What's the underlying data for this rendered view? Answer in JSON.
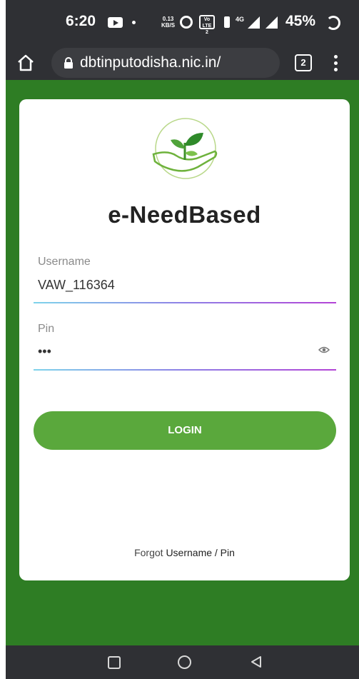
{
  "status_bar": {
    "time": "6:20",
    "net_speed_value": "0.13",
    "net_speed_unit": "KB/S",
    "volte_label": "Vo LTE 2",
    "network_type": "4G",
    "battery": "45%"
  },
  "browser": {
    "url": "dbtinputodisha.nic.in/",
    "tab_count": "2"
  },
  "login": {
    "app_title": "e-NeedBased",
    "username_label": "Username",
    "username_value": "VAW_116364",
    "pin_label": "Pin",
    "pin_value": "•••",
    "login_label": "LOGIN",
    "forgot_prefix": "Forgot",
    "forgot_link": "Username / Pin"
  },
  "colors": {
    "page_background": "#2e7d24",
    "button": "#5aa83c",
    "system_bar": "#2f3034"
  },
  "icons": [
    "home-icon",
    "lock-icon",
    "tabs-icon",
    "menu-icon",
    "eye-icon",
    "plant-hand-logo",
    "recent-apps-icon",
    "nav-home-icon",
    "back-icon"
  ]
}
